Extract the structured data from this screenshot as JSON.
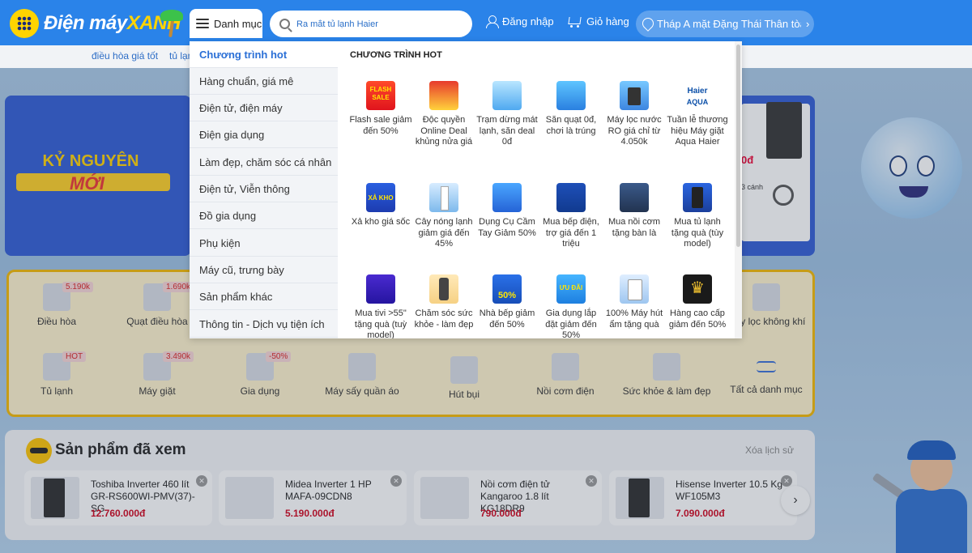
{
  "header": {
    "logo_text_a": "Điện máy",
    "logo_text_b": "XANH",
    "menu_label": "Danh mục",
    "search_placeholder": "Ra mắt tủ lạnh Haier",
    "login_label": "Đăng nhập",
    "cart_label": "Giỏ hàng",
    "location_text": "Tháp A mặt Đặng Thái Thân tòa...",
    "location_chevron": "›",
    "colors": {
      "primary": "#2a83e9",
      "accent": "#ffd400"
    }
  },
  "subnav": [
    "điều hòa giá tốt",
    "tủ lạnh"
  ],
  "dropdown": {
    "categories": [
      "Chương trình hot",
      "Hàng chuẩn, giá mê",
      "Điện tử, điện máy",
      "Điện gia dụng",
      "Làm đẹp, chăm sóc cá nhân",
      "Điện tử, Viễn thông",
      "Đồ gia dụng",
      "Phụ kiện",
      "Máy cũ, trưng bày",
      "Sản phẩm khác",
      "Thông tin - Dịch vụ tiện ích"
    ],
    "active_index": 0,
    "heading": "CHƯƠNG TRÌNH HOT",
    "promos": [
      {
        "label": "Flash sale giảm đến 50%",
        "icon": "flash-sale-icon"
      },
      {
        "label": "Độc quyền Online Deal khủng nửa giá",
        "icon": "online-deal-icon"
      },
      {
        "label": "Trạm dừng mát lạnh, săn deal 0đ",
        "icon": "cool-station-icon"
      },
      {
        "label": "Săn quạt 0đ, chơi là trúng",
        "icon": "fan-deal-icon"
      },
      {
        "label": "Máy lọc nước RO giá chỉ từ 4.050k",
        "icon": "water-purifier-icon"
      },
      {
        "label": "Tuần lễ thương hiệu Máy giặt Aqua Haier",
        "icon": "haier-aqua-icon"
      },
      {
        "label": "Xả kho giá sốc",
        "icon": "clearance-icon"
      },
      {
        "label": "Cây nóng lạnh giảm giá đến 45%",
        "icon": "water-dispenser-icon"
      },
      {
        "label": "Dụng Cụ Cầm Tay Giảm 50%",
        "icon": "hand-tools-icon"
      },
      {
        "label": "Mua bếp điện, trợ giá đến 1 triệu",
        "icon": "electric-stove-icon"
      },
      {
        "label": "Mua nồi cơm tặng bàn là",
        "icon": "rice-cooker-icon"
      },
      {
        "label": "Mua tủ lạnh tặng quà (tùy model)",
        "icon": "fridge-gift-icon"
      },
      {
        "label": "Mua tivi >55\" tặng quà (tuỳ model)",
        "icon": "tv-gift-icon"
      },
      {
        "label": "Chăm sóc sức khỏe - làm đẹp",
        "icon": "health-beauty-icon"
      },
      {
        "label": "Nhà bếp giảm đến 50%",
        "icon": "kitchen-sale-icon"
      },
      {
        "label": "Gia dụng lắp đặt giảm đến 50%",
        "icon": "home-appliance-icon"
      },
      {
        "label": "100% Máy hút ẩm tặng quà",
        "icon": "dehumidifier-icon"
      },
      {
        "label": "Hàng cao cấp giảm đến 50%",
        "icon": "premium-crown-icon"
      }
    ]
  },
  "banner": {
    "line1": "KỶ NGUYÊN",
    "line2": "MỚI",
    "side_price": "0đ",
    "side_text": "3 cánh"
  },
  "categories_grid": [
    {
      "label": "Điều hòa",
      "tag": "5.190k"
    },
    {
      "label": "Quạt điều hòa",
      "tag": "1.690k"
    },
    {
      "label": "Máy lọc không khí",
      "tag": ""
    },
    {
      "label": "Tủ lạnh",
      "tag": "HOT"
    },
    {
      "label": "Máy giặt",
      "tag": "3.490k"
    },
    {
      "label": "Gia dụng",
      "tag": "-50%"
    },
    {
      "label": "Máy sấy quần áo",
      "tag": ""
    },
    {
      "label": "Hút bụi",
      "tag": ""
    },
    {
      "label": "Nồi cơm điện",
      "tag": ""
    },
    {
      "label": "Sức khỏe & làm đẹp",
      "tag": ""
    },
    {
      "label": "Tất cả danh mục",
      "tag": ""
    }
  ],
  "viewed": {
    "title": "Sản phẩm đã xem",
    "clear_label": "Xóa lịch sử",
    "next_label": "›",
    "close_label": "✕",
    "items": [
      {
        "name": "Toshiba Inverter 460 lít GR-RS600WI-PMV(37)-SG",
        "price": "12.760.000đ"
      },
      {
        "name": "Midea Inverter 1 HP MAFA-09CDN8",
        "price": "5.190.000đ"
      },
      {
        "name": "Nồi cơm điện tử Kangaroo 1.8 lít KG18DR9",
        "price": "790.000đ"
      },
      {
        "name": "Hisense Inverter 10.5 Kg WF105M3",
        "price": "7.090.000đ"
      }
    ]
  }
}
